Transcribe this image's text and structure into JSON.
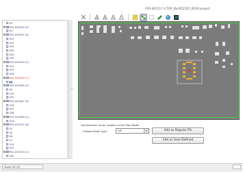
{
  "window": {
    "title": "P35-001117-3,TOP_Doc952167_REV0.project"
  },
  "toolbar": {
    "icons": [
      "close-icon",
      "zoom-fit-icon",
      "zoom-in-icon",
      "zoom-out-icon",
      "highlight-icon",
      "layer-icon",
      "select-icon",
      "pencil-icon",
      "color-icon",
      "palette-icon"
    ]
  },
  "tree": {
    "items": [
      {
        "label": "U3",
        "kind": "file",
        "indent": 2
      },
      {
        "label": "P41-001055 (2)",
        "kind": "folder",
        "indent": 0
      },
      {
        "label": "U4",
        "kind": "file",
        "indent": 2
      },
      {
        "label": "P41-001057 (4)",
        "kind": "folder",
        "indent": 0
      },
      {
        "label": "U12",
        "kind": "file",
        "indent": 2
      },
      {
        "label": "U13",
        "kind": "file",
        "indent": 2
      },
      {
        "label": "U24",
        "kind": "file",
        "indent": 2
      },
      {
        "label": "U29",
        "kind": "file",
        "indent": 2
      },
      {
        "label": "U33",
        "kind": "file",
        "indent": 2
      },
      {
        "label": "U35",
        "kind": "file",
        "indent": 2
      },
      {
        "label": "P41-001059 (1)",
        "kind": "folder",
        "indent": 0
      },
      {
        "label": "U11",
        "kind": "file",
        "indent": 2
      },
      {
        "label": "U23",
        "kind": "file",
        "indent": 2
      },
      {
        "label": "U34",
        "kind": "file",
        "indent": 2
      },
      {
        "label": "P41-001059 (1)",
        "kind": "folder",
        "indent": 0,
        "state": "red"
      },
      {
        "label": "U8",
        "kind": "file",
        "indent": 2,
        "state": "selected"
      },
      {
        "label": "P41-001065 (3)",
        "kind": "folder",
        "indent": 0
      },
      {
        "label": "U9",
        "kind": "file",
        "indent": 2
      },
      {
        "label": "U10",
        "kind": "file",
        "indent": 2
      },
      {
        "label": "U31",
        "kind": "file",
        "indent": 2
      },
      {
        "label": "P41-001067 (3)",
        "kind": "folder",
        "indent": 0
      },
      {
        "label": "U16",
        "kind": "file",
        "indent": 2
      },
      {
        "label": "U27",
        "kind": "file",
        "indent": 2
      },
      {
        "label": "U28",
        "kind": "file",
        "indent": 2
      },
      {
        "label": "P41-001069 (1)",
        "kind": "folder",
        "indent": 0
      },
      {
        "label": "U14",
        "kind": "file",
        "indent": 2
      },
      {
        "label": "P41-001071 (6)",
        "kind": "folder",
        "indent": 0
      },
      {
        "label": "U2",
        "kind": "file",
        "indent": 2
      },
      {
        "label": "U5",
        "kind": "file",
        "indent": 2
      },
      {
        "label": "U6",
        "kind": "file",
        "indent": 2
      },
      {
        "label": "U7",
        "kind": "file",
        "indent": 2
      },
      {
        "label": "U14",
        "kind": "file",
        "indent": 2
      },
      {
        "label": "U22",
        "kind": "file",
        "indent": 2
      },
      {
        "label": "P41-001074 (1)",
        "kind": "folder",
        "indent": 0
      },
      {
        "label": "U25",
        "kind": "file",
        "indent": 2
      }
    ]
  },
  "divider": {
    "arrow": "«"
  },
  "controls": {
    "status_message": "Use Selected Center Update current Part Model",
    "choose_label": "Choose Model Type:",
    "model_value": "DIP",
    "add_regular_label": "Add as Regular Pin",
    "add_user_label": "Add as User-Defined"
  },
  "statusbar": {
    "text": "Scale: 5X (9)"
  },
  "colors": {
    "canvas": "#7a7a7a",
    "selection_outline": "#3fd23f",
    "pin_highlight": "#f0b030",
    "selected_pin": "#e03030"
  }
}
